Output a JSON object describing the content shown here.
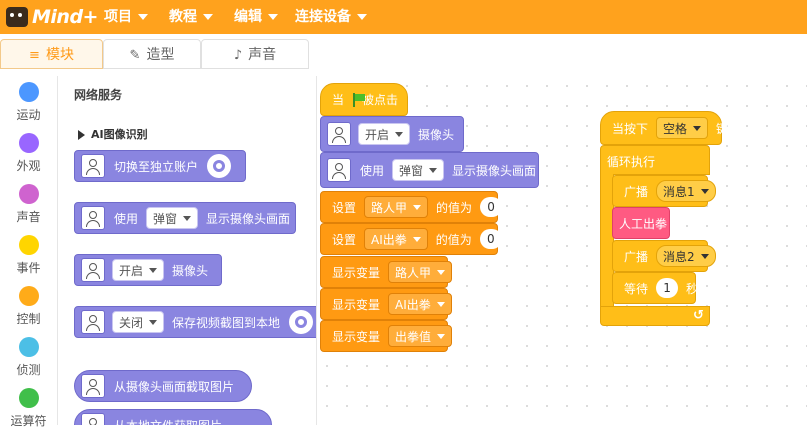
{
  "app": {
    "brand": "Mind+"
  },
  "menu": [
    {
      "label": "项目"
    },
    {
      "label": "教程"
    },
    {
      "label": "编辑"
    },
    {
      "label": "连接设备"
    }
  ],
  "tabs": [
    {
      "label": "模块",
      "icon": "blocks-icon",
      "active": true
    },
    {
      "label": "造型",
      "icon": "brush-icon",
      "active": false
    },
    {
      "label": "声音",
      "icon": "speaker-icon",
      "active": false
    }
  ],
  "categories": [
    {
      "label": "运动",
      "color": "#4c97ff"
    },
    {
      "label": "外观",
      "color": "#9966ff"
    },
    {
      "label": "声音",
      "color": "#cf63cf"
    },
    {
      "label": "事件",
      "color": "#ffd500"
    },
    {
      "label": "控制",
      "color": "#ffab19"
    },
    {
      "label": "侦测",
      "color": "#4cbfe6"
    },
    {
      "label": "运算符",
      "color": "#40bf4a"
    }
  ],
  "palette": {
    "title": "网络服务",
    "subsection": "AI图像识别",
    "blocks": {
      "switch_account": "切换至独立账户",
      "use_popup_prefix": "使用",
      "use_popup_dropdown": "弹窗",
      "use_popup_suffix": "显示摄像头画面",
      "camera_on_dropdown": "开启",
      "camera_on_suffix": "摄像头",
      "save_dropdown": "关闭",
      "save_suffix": "保存视频截图到本地",
      "capture": "从摄像头画面截取图片",
      "from_file": "从本地文件获取图片"
    }
  },
  "script1": {
    "hat_prefix": "当",
    "hat_suffix": "被点击",
    "cam_on_dropdown": "开启",
    "cam_on_suffix": "摄像头",
    "use_prefix": "使用",
    "use_dropdown": "弹窗",
    "use_suffix": "显示摄像头画面",
    "set1_prefix": "设置",
    "set1_var": "路人甲",
    "set1_mid": "的值为",
    "set1_value": "0",
    "set2_prefix": "设置",
    "set2_var": "AI出拳",
    "set2_mid": "的值为",
    "set2_value": "0",
    "show1_prefix": "显示变量",
    "show1_var": "路人甲",
    "show2_prefix": "显示变量",
    "show2_var": "AI出拳",
    "show3_prefix": "显示变量",
    "show3_var": "出拳值"
  },
  "script2": {
    "hat_prefix": "当按下",
    "hat_key": "空格",
    "hat_suffix": "键",
    "loop_label": "循环执行",
    "broadcast1_prefix": "广播",
    "broadcast1_msg": "消息1",
    "pink_block": "人工出拳",
    "broadcast2_prefix": "广播",
    "broadcast2_msg": "消息2",
    "wait_prefix": "等待",
    "wait_value": "1",
    "wait_suffix": "秒"
  }
}
